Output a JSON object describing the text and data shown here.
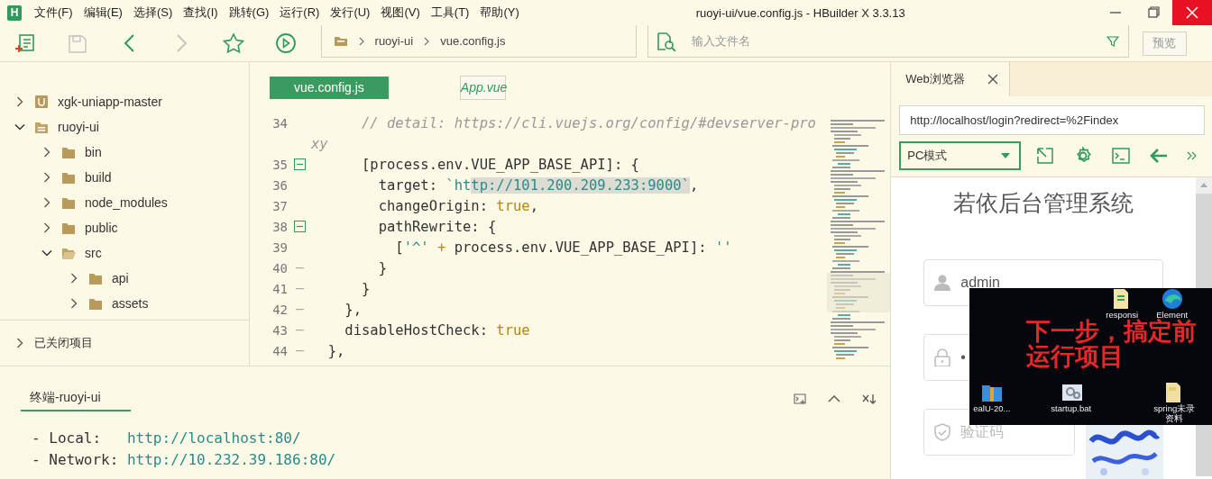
{
  "window": {
    "logo": "H",
    "title": "ruoyi-ui/vue.config.js - HBuilder X 3.3.13"
  },
  "menu": [
    "文件(F)",
    "编辑(E)",
    "选择(S)",
    "查找(I)",
    "跳转(G)",
    "运行(R)",
    "发行(U)",
    "视图(V)",
    "工具(T)",
    "帮助(Y)"
  ],
  "toolbar": {
    "buttons": [
      {
        "kind": "new-file",
        "disabled": false
      },
      {
        "kind": "save",
        "disabled": true
      },
      {
        "kind": "back",
        "disabled": false
      },
      {
        "kind": "forward",
        "disabled": true
      },
      {
        "kind": "favorite",
        "disabled": false
      },
      {
        "kind": "run",
        "disabled": false
      }
    ],
    "breadcrumb": [
      "ruoyi-ui",
      "vue.config.js"
    ],
    "file_search": {
      "placeholder": "输入文件名"
    },
    "preview_button": "预览"
  },
  "sidebar": {
    "tree": [
      {
        "label": "xgk-uniapp-master",
        "kind": "uniapp-project",
        "expanded": false
      },
      {
        "label": "ruoyi-ui",
        "kind": "project",
        "expanded": true,
        "children": [
          {
            "label": "bin",
            "kind": "folder",
            "expanded": false
          },
          {
            "label": "build",
            "kind": "folder",
            "expanded": false
          },
          {
            "label": "node_modules",
            "kind": "folder",
            "expanded": false
          },
          {
            "label": "public",
            "kind": "folder",
            "expanded": false
          },
          {
            "label": "src",
            "kind": "folder",
            "expanded": true,
            "children": [
              {
                "label": "api",
                "kind": "folder",
                "expanded": false
              },
              {
                "label": "assets",
                "kind": "folder",
                "expanded": false
              }
            ]
          }
        ]
      }
    ],
    "closed_projects": {
      "label": "已关闭项目",
      "expanded": false
    }
  },
  "editor": {
    "tabs": [
      {
        "label": "vue.config.js",
        "selected": true,
        "preview": false
      },
      {
        "label": "App.vue",
        "selected": false,
        "preview": true
      }
    ],
    "lines": [
      {
        "number": "34",
        "tokens": [
          {
            "text": "      // detail: https://cli.vuejs.org/config/#devserver-pro",
            "kind": "comment"
          }
        ]
      },
      {
        "tokens": [
          {
            "text": "xy",
            "kind": "comment"
          }
        ]
      },
      {
        "number": "35",
        "kind": "fold-start",
        "tokens": [
          {
            "text": "      [process.env.VUE_APP_BASE_API]: {",
            "kind": "plain"
          }
        ]
      },
      {
        "number": "36",
        "tokens": [
          {
            "text": "        target: ",
            "kind": "plain"
          },
          {
            "text": "`ht",
            "kind": "string"
          },
          {
            "text": "tp://101.200.209.233:9000`",
            "kind": "selection"
          },
          {
            "text": ",",
            "kind": "plain"
          }
        ]
      },
      {
        "number": "37",
        "tokens": [
          {
            "text": "        changeOrigin: ",
            "kind": "plain"
          },
          {
            "text": "true",
            "kind": "keyword"
          },
          {
            "text": ",",
            "kind": "plain"
          }
        ]
      },
      {
        "number": "38",
        "kind": "fold-start",
        "tokens": [
          {
            "text": "        pathRewrite: {",
            "kind": "plain"
          }
        ]
      },
      {
        "number": "39",
        "tokens": [
          {
            "text": "          [",
            "kind": "plain"
          },
          {
            "text": "'^'",
            "kind": "string"
          },
          {
            "text": " + ",
            "kind": "keyword"
          },
          {
            "text": "process.env.VUE_APP_BASE_API]: ",
            "kind": "plain"
          },
          {
            "text": "''",
            "kind": "string"
          }
        ]
      },
      {
        "number": "40",
        "kind": "fold-end",
        "tokens": [
          {
            "text": "        }",
            "kind": "plain"
          }
        ]
      },
      {
        "number": "41",
        "kind": "fold-end",
        "tokens": [
          {
            "text": "      }",
            "kind": "plain"
          }
        ]
      },
      {
        "number": "42",
        "kind": "fold-end",
        "tokens": [
          {
            "text": "    },",
            "kind": "plain"
          }
        ]
      },
      {
        "number": "43",
        "kind": "fold-end",
        "tokens": [
          {
            "text": "    disableHostCheck: ",
            "kind": "plain"
          },
          {
            "text": "true",
            "kind": "keyword"
          }
        ]
      },
      {
        "number": "44",
        "kind": "fold-end",
        "tokens": [
          {
            "text": "  },",
            "kind": "plain"
          }
        ]
      }
    ]
  },
  "terminal": {
    "tab": {
      "label": "终端-ruoyi-ui",
      "selected": true
    },
    "lines": [
      [
        {
          "text": "- Local:   ",
          "kind": "plain"
        },
        {
          "text": "http://localhost:80/",
          "kind": "url"
        }
      ],
      [
        {
          "text": "- Network: ",
          "kind": "plain"
        },
        {
          "text": "http://10.232.39.186:80/",
          "kind": "url"
        }
      ]
    ]
  },
  "browser": {
    "tab": {
      "label": "Web浏览器"
    },
    "url": "http://localhost/login?redirect=%2Findex",
    "mode": "PC模式",
    "page": {
      "title": "若依后台管理系统",
      "fields": [
        {
          "kind": "user",
          "value": "admin"
        },
        {
          "kind": "password",
          "value": "•"
        },
        {
          "kind": "captcha",
          "placeholder": "验证码"
        }
      ]
    }
  },
  "desktop_overlay": {
    "caption": [
      "下一步，搞定前",
      "运行项目"
    ],
    "icons": [
      {
        "kind": "document",
        "label": "responsi"
      },
      {
        "kind": "browser",
        "label": "Element"
      },
      {
        "kind": "archive",
        "label": "ealU-20..."
      },
      {
        "kind": "script",
        "label": "startup.bat"
      },
      {
        "kind": "folder",
        "label": "spring未录资料"
      }
    ]
  }
}
